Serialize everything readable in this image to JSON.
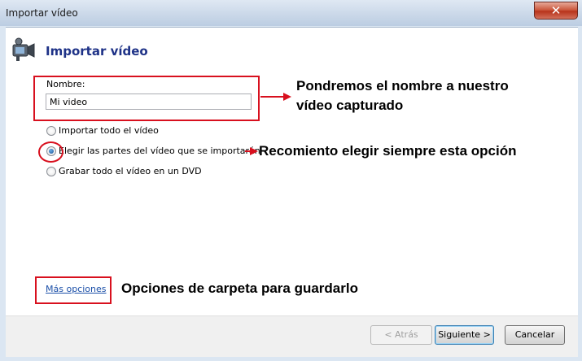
{
  "window": {
    "title": "Importar vídeo",
    "close_label": "✕"
  },
  "header": {
    "icon": "video-camera-icon",
    "title": "Importar vídeo"
  },
  "name_field": {
    "label": "Nombre:",
    "value": "Mi video"
  },
  "options": [
    {
      "label": "Importar todo el vídeo",
      "checked": false
    },
    {
      "label": "Elegir las partes del vídeo que se importarán",
      "checked": true
    },
    {
      "label": "Grabar todo el vídeo en un DVD",
      "checked": false
    }
  ],
  "more_options_link": "Más opciones",
  "buttons": {
    "back": "< Atrás",
    "next": "Siguiente >",
    "cancel": "Cancelar"
  },
  "annotations": {
    "name_line1": "Pondremos el nombre a nuestro",
    "name_line2": "vídeo capturado",
    "option": "Recomiento elegir siempre esta opción",
    "folder": "Opciones de carpeta para guardarlo"
  },
  "colors": {
    "annotation_red": "#d8101e",
    "heading_blue": "#1e3287",
    "link_blue": "#1b4fa8"
  }
}
